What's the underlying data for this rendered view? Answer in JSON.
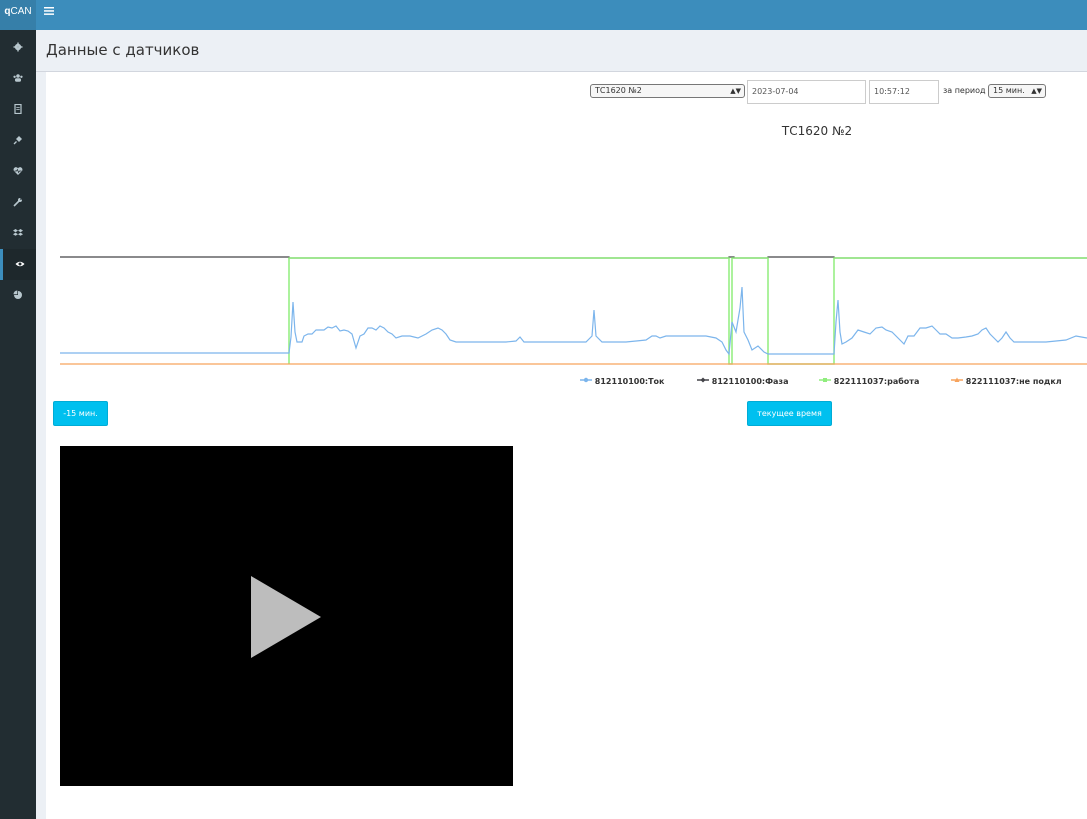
{
  "app": {
    "logo_bold": "q",
    "logo_rest": "CAN"
  },
  "header": {
    "title": "Данные с датчиков"
  },
  "sidebar": {
    "items": [
      {
        "icon": "gear-icon"
      },
      {
        "icon": "users-icon"
      },
      {
        "icon": "document-icon"
      },
      {
        "icon": "plug-icon"
      },
      {
        "icon": "heartbeat-icon"
      },
      {
        "icon": "wrench-icon"
      },
      {
        "icon": "dropbox-icon"
      },
      {
        "icon": "eye-icon",
        "active": true
      },
      {
        "icon": "pie-chart-icon"
      }
    ]
  },
  "controls": {
    "vehicle_select": "ТС1620 №2",
    "date": "2023-07-04",
    "time": "10:57:12",
    "period_label": "за период",
    "period_select": "15 мин."
  },
  "buttons": {
    "back": "-15 мин.",
    "now": "текущее время"
  },
  "chart_data": {
    "type": "line",
    "title": "ТС1620 №2",
    "xlabel": "",
    "ylabel": "",
    "grid": false,
    "legend": "bottom",
    "series": [
      {
        "name": "812110100:Ток",
        "color": "#7cb5ec"
      },
      {
        "name": "812110100:Фаза",
        "color": "#434348"
      },
      {
        "name": "822111037:работа",
        "color": "#90ed7d"
      },
      {
        "name": "822111037:не подкл",
        "color": "#f7a35c"
      }
    ]
  },
  "video": {
    "icon": "play-icon"
  }
}
